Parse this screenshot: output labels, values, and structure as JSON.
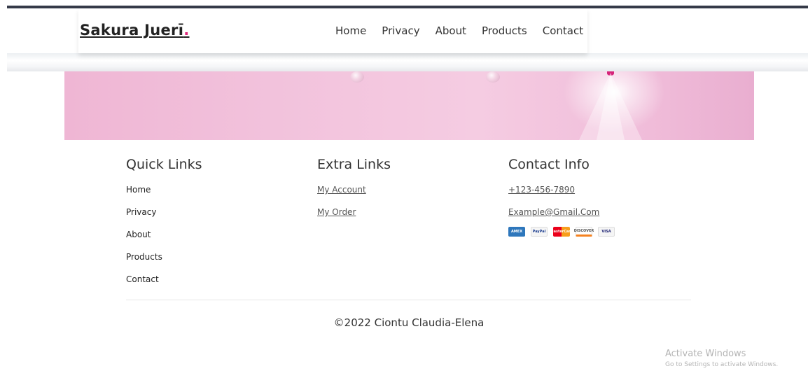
{
  "header": {
    "logo_text": "Sakura Juerī",
    "logo_dot": ".",
    "nav": [
      "Home",
      "Privacy",
      "About",
      "Products",
      "Contact"
    ]
  },
  "footer": {
    "quick_links": {
      "title": "Quick Links",
      "items": [
        "Home",
        "Privacy",
        "About",
        "Products",
        "Contact"
      ]
    },
    "extra_links": {
      "title": "Extra Links",
      "items": [
        "My Account",
        "My Order"
      ]
    },
    "contact_info": {
      "title": "Contact Info",
      "phone": "+123-456-7890",
      "email": "Example@Gmail.Com",
      "payment_cards": [
        "AMEX",
        "PayPal",
        "MasterCard",
        "DISCOVER",
        "VISA"
      ]
    },
    "copyright": "©2022 Ciontu Claudia-Elena"
  },
  "watermark": {
    "line1": "Activate Windows",
    "line2": "Go to Settings to activate Windows."
  },
  "colors": {
    "accent": "#e0267a",
    "topbar": "#353a48",
    "hero_pink": "#f2c2dc"
  }
}
